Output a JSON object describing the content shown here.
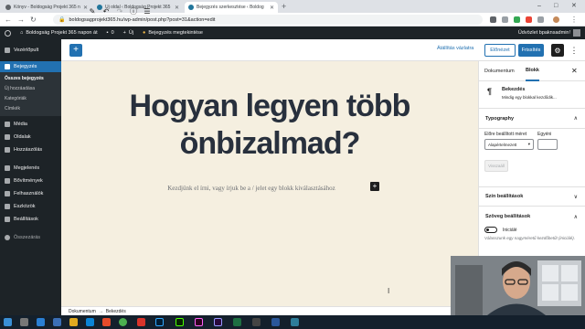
{
  "browser": {
    "tabs": [
      {
        "title": "Könyv - Boldogság Projekt 365 n",
        "favicon": "page-icon",
        "active": false
      },
      {
        "title": "Új oldal ‹ Boldogság Projekt 365",
        "favicon": "wordpress-icon",
        "active": false
      },
      {
        "title": "Bejegyzés szerkesztése ‹ Boldog",
        "favicon": "wordpress-icon",
        "active": true
      }
    ],
    "new_tab": "+",
    "url": "boldogsagprojekt365.hu/wp-admin/post.php?post=31&action=edit",
    "window_controls": [
      "–",
      "□",
      "✕"
    ]
  },
  "admin_bar": {
    "site_name": "Boldogság Projekt 365 napon át",
    "comments_count": "0",
    "new_label": "Új",
    "view_post": "Bejegyzés megtekintése",
    "greeting": "Üdvözlet bpaknsadmin!"
  },
  "sidebar": {
    "items": [
      {
        "label": "Vezérlőpult",
        "icon": "dashboard-icon"
      },
      {
        "label": "Bejegyzés",
        "icon": "pin-icon",
        "active": true
      },
      {
        "label": "Média",
        "icon": "media-icon"
      },
      {
        "label": "Oldalak",
        "icon": "pages-icon"
      },
      {
        "label": "Hozzászólás",
        "icon": "comments-icon"
      },
      {
        "label": "Megjelenés",
        "icon": "appearance-icon"
      },
      {
        "label": "Bővítmények",
        "icon": "plugins-icon"
      },
      {
        "label": "Felhasználók",
        "icon": "users-icon"
      },
      {
        "label": "Eszközök",
        "icon": "tools-icon"
      },
      {
        "label": "Beállítások",
        "icon": "settings-icon"
      },
      {
        "label": "Összezárás",
        "icon": "collapse-icon"
      }
    ],
    "submenu": [
      "Összes bejegyzés",
      "Új hozzáadása",
      "Kategóriák",
      "Címkék"
    ]
  },
  "editor_toolbar": {
    "save_draft": "Átállítás vázlatra",
    "preview": "Előnézet",
    "publish": "Frissítés"
  },
  "canvas": {
    "title": "Hogyan legyen több önbizalmad?",
    "placeholder": "Kezdjünk el írni, vagy írjuk be a / jelet egy blokk kiválasztásához",
    "background": "#f5efe0"
  },
  "breadcrumb": {
    "root": "Dokumentum",
    "separator": "→",
    "current": "Bekezdés"
  },
  "panel": {
    "tab_document": "Dokumentum",
    "tab_block": "Blokk",
    "close": "✕",
    "block_name": "Bekezdés",
    "block_desc": "Mindig egy blokkal kezdődik...",
    "typography": "Typography",
    "preset_label": "Előre beállított méret",
    "custom_label": "Egyéni",
    "preset_value": "Alapértelmezett",
    "reset": "Visszaáll",
    "color_settings": "Szín beállítások",
    "text_settings": "Szöveg beállítások",
    "dropcap_label": "Iniciálé",
    "dropcap_desc": "Válasszunk egy nagyméretű kezdőbetűt (iniciálé)."
  },
  "colors": {
    "wp_blue": "#2271b1",
    "admin_dark": "#1d2327",
    "canvas_bg": "#f5efe0"
  }
}
